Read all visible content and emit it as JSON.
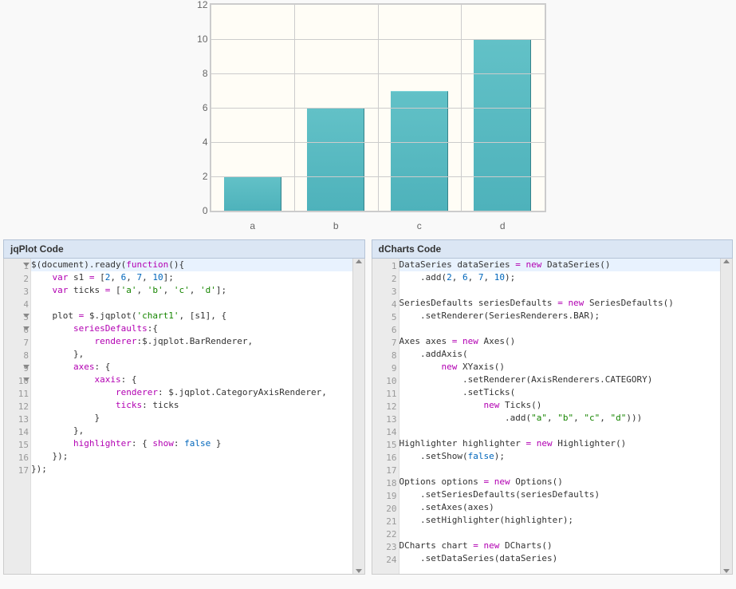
{
  "chart_data": {
    "type": "bar",
    "categories": [
      "a",
      "b",
      "c",
      "d"
    ],
    "values": [
      2,
      6,
      7,
      10
    ],
    "ylim": [
      0,
      12
    ],
    "yticks": [
      0,
      2,
      4,
      6,
      8,
      10,
      12
    ],
    "title": "",
    "xlabel": "",
    "ylabel": ""
  },
  "panels": {
    "left": {
      "title": "jqPlot Code"
    },
    "right": {
      "title": "dCharts Code"
    }
  },
  "code": {
    "jqplot": [
      {
        "n": 1,
        "fold": true,
        "hl": true,
        "html": "<span class='p'>$(</span><span class='id'>document</span><span class='p'>).</span><span class='fn'>ready</span><span class='p'>(</span><span class='k'>function</span><span class='p'>(){</span>"
      },
      {
        "n": 2,
        "html": "    <span class='k'>var</span> s1 <span class='k'>=</span> <span class='p'>[</span><span class='n'>2</span>, <span class='n'>6</span>, <span class='n'>7</span>, <span class='n'>10</span><span class='p'>];</span>"
      },
      {
        "n": 3,
        "html": "    <span class='k'>var</span> ticks <span class='k'>=</span> <span class='p'>[</span><span class='s'>'a'</span>, <span class='s'>'b'</span>, <span class='s'>'c'</span>, <span class='s'>'d'</span><span class='p'>];</span>"
      },
      {
        "n": 4,
        "html": " "
      },
      {
        "n": 5,
        "fold": true,
        "html": "    plot <span class='k'>=</span> $.<span class='fn'>jqplot</span>(<span class='s'>'chart1'</span>, [s1], {"
      },
      {
        "n": 6,
        "fold": true,
        "html": "        <span class='k'>seriesDefaults</span>:{"
      },
      {
        "n": 7,
        "html": "            <span class='k'>renderer</span>:$.jqplot.BarRenderer,"
      },
      {
        "n": 8,
        "html": "        },"
      },
      {
        "n": 9,
        "fold": true,
        "html": "        <span class='k'>axes</span>: {"
      },
      {
        "n": 10,
        "fold": true,
        "html": "            <span class='k'>xaxis</span>: {"
      },
      {
        "n": 11,
        "html": "                <span class='k'>renderer</span>: $.jqplot.CategoryAxisRenderer,"
      },
      {
        "n": 12,
        "html": "                <span class='k'>ticks</span>: ticks"
      },
      {
        "n": 13,
        "html": "            }"
      },
      {
        "n": 14,
        "html": "        },"
      },
      {
        "n": 15,
        "html": "        <span class='k'>highlighter</span>: { <span class='k'>show</span>: <span class='n'>false</span> }"
      },
      {
        "n": 16,
        "html": "    <span class='p'>});</span>"
      },
      {
        "n": 17,
        "html": "<span class='p'>});</span>"
      }
    ],
    "dcharts": [
      {
        "n": 1,
        "hl": true,
        "html": "<span class='id'>DataSeries</span> dataSeries <span class='k'>=</span> <span class='k'>new</span> <span class='fn'>DataSeries</span>()"
      },
      {
        "n": 2,
        "html": "    .<span class='fn'>add</span>(<span class='n'>2</span>, <span class='n'>6</span>, <span class='n'>7</span>, <span class='n'>10</span>);"
      },
      {
        "n": 3,
        "html": " "
      },
      {
        "n": 4,
        "html": "<span class='id'>SeriesDefaults</span> seriesDefaults <span class='k'>=</span> <span class='k'>new</span> <span class='fn'>SeriesDefaults</span>()"
      },
      {
        "n": 5,
        "html": "    .<span class='fn'>setRenderer</span>(SeriesRenderers.BAR);"
      },
      {
        "n": 6,
        "html": " "
      },
      {
        "n": 7,
        "html": "<span class='id'>Axes</span> axes <span class='k'>=</span> <span class='k'>new</span> <span class='fn'>Axes</span>()"
      },
      {
        "n": 8,
        "html": "    .<span class='fn'>addAxis</span>("
      },
      {
        "n": 9,
        "html": "        <span class='k'>new</span> <span class='fn'>XYaxis</span>()"
      },
      {
        "n": 10,
        "html": "            .<span class='fn'>setRenderer</span>(AxisRenderers.CATEGORY)"
      },
      {
        "n": 11,
        "html": "            .<span class='fn'>setTicks</span>("
      },
      {
        "n": 12,
        "html": "                <span class='k'>new</span> <span class='fn'>Ticks</span>()"
      },
      {
        "n": 13,
        "html": "                    .<span class='fn'>add</span>(<span class='s'>\"a\"</span>, <span class='s'>\"b\"</span>, <span class='s'>\"c\"</span>, <span class='s'>\"d\"</span>)))"
      },
      {
        "n": 14,
        "html": " "
      },
      {
        "n": 15,
        "html": "<span class='id'>Highlighter</span> highlighter <span class='k'>=</span> <span class='k'>new</span> <span class='fn'>Highlighter</span>()"
      },
      {
        "n": 16,
        "html": "    .<span class='fn'>setShow</span>(<span class='n'>false</span>);"
      },
      {
        "n": 17,
        "html": " "
      },
      {
        "n": 18,
        "html": "<span class='id'>Options</span> options <span class='k'>=</span> <span class='k'>new</span> <span class='fn'>Options</span>()"
      },
      {
        "n": 19,
        "html": "    .<span class='fn'>setSeriesDefaults</span>(seriesDefaults)"
      },
      {
        "n": 20,
        "html": "    .<span class='fn'>setAxes</span>(axes)"
      },
      {
        "n": 21,
        "html": "    .<span class='fn'>setHighlighter</span>(highlighter);"
      },
      {
        "n": 22,
        "html": " "
      },
      {
        "n": 23,
        "html": "<span class='id'>DCharts</span> chart <span class='k'>=</span> <span class='k'>new</span> <span class='fn'>DCharts</span>()"
      },
      {
        "n": 24,
        "html": "    .<span class='fn'>setDataSeries</span>(dataSeries)"
      }
    ]
  }
}
